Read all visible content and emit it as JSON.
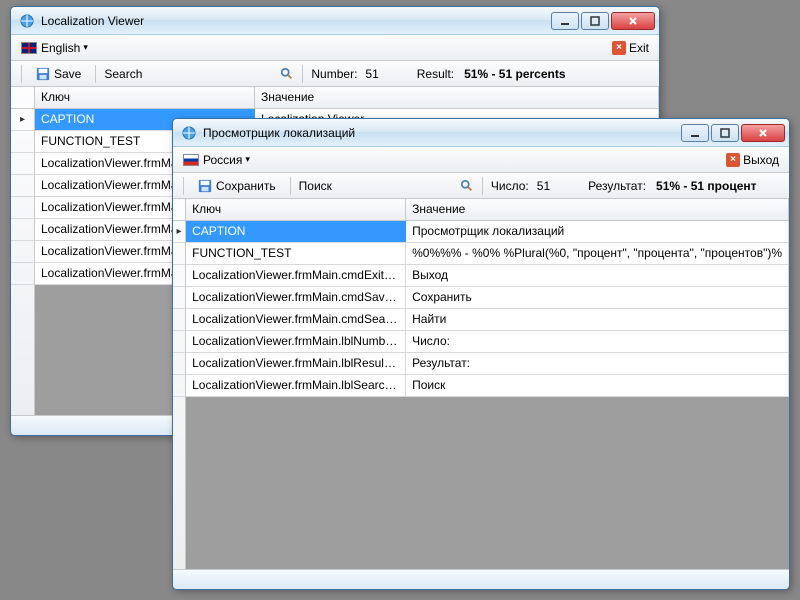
{
  "window1": {
    "title": "Localization Viewer",
    "language": "English",
    "exit_label": "Exit",
    "save_label": "Save",
    "search_label": "Search",
    "number_label": "Number:",
    "number_value": "51",
    "result_label": "Result:",
    "result_value": "51% - 51 percents",
    "col_key": "Ключ",
    "col_val": "Значение",
    "rows": [
      {
        "key": "CAPTION",
        "val": "Localization Viewer"
      },
      {
        "key": "FUNCTION_TEST",
        "val": ""
      },
      {
        "key": "LocalizationViewer.frmMain.cmdExit_Text",
        "val": ""
      },
      {
        "key": "LocalizationViewer.frmMain.cmdSave_Text",
        "val": ""
      },
      {
        "key": "LocalizationViewer.frmMain.cmdSearch_Text",
        "val": ""
      },
      {
        "key": "LocalizationViewer.frmMain.lblNumber_Text",
        "val": ""
      },
      {
        "key": "LocalizationViewer.frmMain.lblResult_Text",
        "val": ""
      },
      {
        "key": "LocalizationViewer.frmMain.lblSearch_Text",
        "val": ""
      }
    ]
  },
  "window2": {
    "title": "Просмотрщик локализаций",
    "language": "Россия",
    "exit_label": "Выход",
    "save_label": "Сохранить",
    "search_label": "Поиск",
    "number_label": "Число:",
    "number_value": "51",
    "result_label": "Результат:",
    "result_value": "51% - 51 процент",
    "col_key": "Ключ",
    "col_val": "Значение",
    "rows": [
      {
        "key": "CAPTION",
        "val": "Просмотрщик локализаций"
      },
      {
        "key": "FUNCTION_TEST",
        "val": "%0%%% - %0% %Plural(%0, \"процент\", \"процента\", \"процентов\")%"
      },
      {
        "key": "LocalizationViewer.frmMain.cmdExit_Text",
        "val": "Выход"
      },
      {
        "key": "LocalizationViewer.frmMain.cmdSave_Text",
        "val": "Сохранить"
      },
      {
        "key": "LocalizationViewer.frmMain.cmdSearch_Text",
        "val": "Найти"
      },
      {
        "key": "LocalizationViewer.frmMain.lblNumber_Text",
        "val": "Число:"
      },
      {
        "key": "LocalizationViewer.frmMain.lblResult_Text",
        "val": "Результат:"
      },
      {
        "key": "LocalizationViewer.frmMain.lblSearch_Text",
        "val": "Поиск"
      }
    ]
  }
}
